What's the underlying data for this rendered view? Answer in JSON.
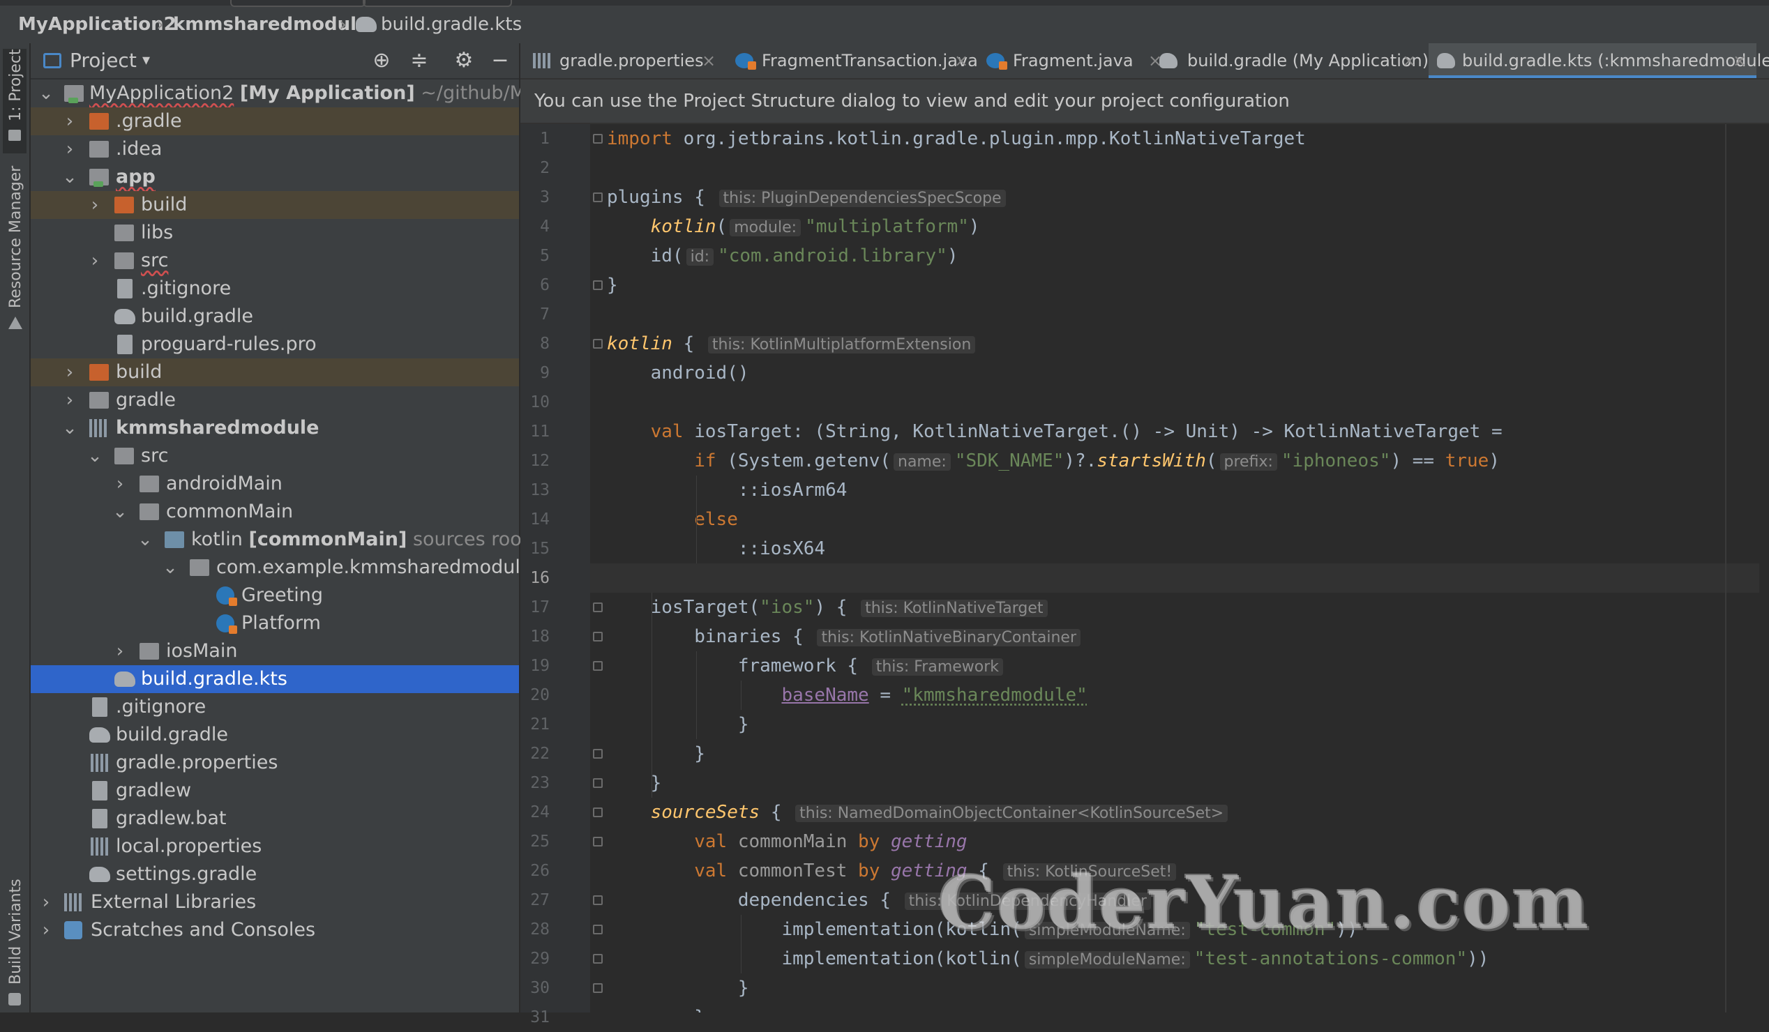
{
  "breadcrumb": {
    "project": "MyApplication2",
    "module": "kmmsharedmodule",
    "file": "build.gradle.kts"
  },
  "sidebar_strip": {
    "project_label": "1: Project",
    "resource_label": "Resource Manager",
    "variants_label": "Build Variants"
  },
  "project_panel": {
    "title": "Project",
    "rows": [
      {
        "label": "MyApplication2",
        "bold_suffix": "[My Application]",
        "dim_suffix": "~/github/MyApp"
      },
      {
        "label": ".gradle"
      },
      {
        "label": ".idea"
      },
      {
        "label": "app"
      },
      {
        "label": "build"
      },
      {
        "label": "libs"
      },
      {
        "label": "src"
      },
      {
        "label": ".gitignore"
      },
      {
        "label": "build.gradle"
      },
      {
        "label": "proguard-rules.pro"
      },
      {
        "label": "build"
      },
      {
        "label": "gradle"
      },
      {
        "label": "kmmsharedmodule"
      },
      {
        "label": "src"
      },
      {
        "label": "androidMain"
      },
      {
        "label": "commonMain"
      },
      {
        "label": "kotlin",
        "bold_suffix": "[commonMain]",
        "dim_suffix": "sources root"
      },
      {
        "label": "com.example.kmmsharedmodule"
      },
      {
        "label": "Greeting"
      },
      {
        "label": "Platform"
      },
      {
        "label": "iosMain"
      },
      {
        "label": "build.gradle.kts"
      },
      {
        "label": ".gitignore"
      },
      {
        "label": "build.gradle"
      },
      {
        "label": "gradle.properties"
      },
      {
        "label": "gradlew"
      },
      {
        "label": "gradlew.bat"
      },
      {
        "label": "local.properties"
      },
      {
        "label": "settings.gradle"
      },
      {
        "label": "External Libraries"
      },
      {
        "label": "Scratches and Consoles"
      }
    ]
  },
  "tabs": [
    {
      "label": "gradle.properties"
    },
    {
      "label": "FragmentTransaction.java"
    },
    {
      "label": "Fragment.java"
    },
    {
      "label": "build.gradle (My Application)"
    },
    {
      "label": "build.gradle.kts (:kmmsharedmodule)"
    }
  ],
  "banner": "You can use the Project Structure dialog to view and edit your project configuration",
  "editor": {
    "current_line": 16,
    "line_numbers": [
      "1",
      "2",
      "3",
      "4",
      "5",
      "6",
      "7",
      "8",
      "9",
      "10",
      "11",
      "12",
      "13",
      "14",
      "15",
      "16",
      "17",
      "18",
      "19",
      "20",
      "21",
      "22",
      "23",
      "24",
      "25",
      "26",
      "27",
      "28",
      "29",
      "30",
      "31"
    ],
    "tokens": {
      "l1_kw": "import",
      "l1_rest": " org.jetbrains.kotlin.gradle.plugin.mpp.KotlinNativeTarget",
      "l3_a": "plugins {",
      "l3_hint": "this: PluginDependenciesSpecScope",
      "l4_fn": "kotlin",
      "l4_b": "(",
      "l4_hint": "module:",
      "l4_str": "\"multiplatform\"",
      "l4_c": ")",
      "l5_a": "id(",
      "l5_hint": "id:",
      "l5_str": "\"com.android.library\"",
      "l5_c": ")",
      "l6_a": "}",
      "l8_fn": "kotlin",
      "l8_b": " {",
      "l8_hint": "this: KotlinMultiplatformExtension",
      "l9_a": "android()",
      "l11_kw": "val",
      "l11_rest": " iosTarget: (String, KotlinNativeTarget.() -> Unit) -> KotlinNativeTarget =",
      "l12_kw": "if",
      "l12_a": " (System.getenv(",
      "l12_hint1": "name:",
      "l12_str1": "\"SDK_NAME\"",
      "l12_b": ")?.",
      "l12_fn": "startsWith",
      "l12_c": "(",
      "l12_hint2": "prefix:",
      "l12_str2": "\"iphoneos\"",
      "l12_d": ") == ",
      "l12_kw2": "true",
      "l12_e": ")",
      "l13_a": "::iosArm64",
      "l14_kw": "else",
      "l15_a": "::iosX64",
      "l17_a": "iosTarget(",
      "l17_str": "\"ios\"",
      "l17_b": ") {",
      "l17_hint": "this: KotlinNativeTarget",
      "l18_a": "binaries {",
      "l18_hint": "this: KotlinNativeBinaryContainer",
      "l19_a": "framework {",
      "l19_hint": "this: Framework",
      "l20_prop": "baseName",
      "l20_a": " = ",
      "l20_str": "\"kmmsharedmodule\"",
      "l21_a": "}",
      "l22_a": "}",
      "l23_a": "}",
      "l24_fn": "sourceSets",
      "l24_b": " {",
      "l24_hint": "this: NamedDomainObjectContainer<KotlinSourceSet>",
      "l25_kw": "val",
      "l25_a": " commonMain ",
      "l25_kw2": "by",
      "l25_fn": "getting",
      "l26_kw": "val",
      "l26_a": " commonTest ",
      "l26_kw2": "by",
      "l26_fn": "getting",
      "l26_b": " {",
      "l26_hint": "this: KotlinSourceSet!",
      "l27_a": "dependencies {",
      "l27_hint": "this: KotlinDependencyHandler",
      "l28_a": "implementation(kotlin(",
      "l28_hint": "simpleModuleName:",
      "l28_str": "\"test-common\"",
      "l28_b": "))",
      "l29_a": "implementation(kotlin(",
      "l29_hint": "simpleModuleName:",
      "l29_str": "\"test-annotations-common\"",
      "l29_b": "))",
      "l30_a": "}",
      "l31_a": "}"
    }
  },
  "watermark": "CoderYuan.com",
  "colors": {
    "selection": "#2f65ca",
    "keyword": "#cc7832",
    "string": "#6a8759",
    "function": "#ffc66d",
    "property": "#9876aa"
  }
}
